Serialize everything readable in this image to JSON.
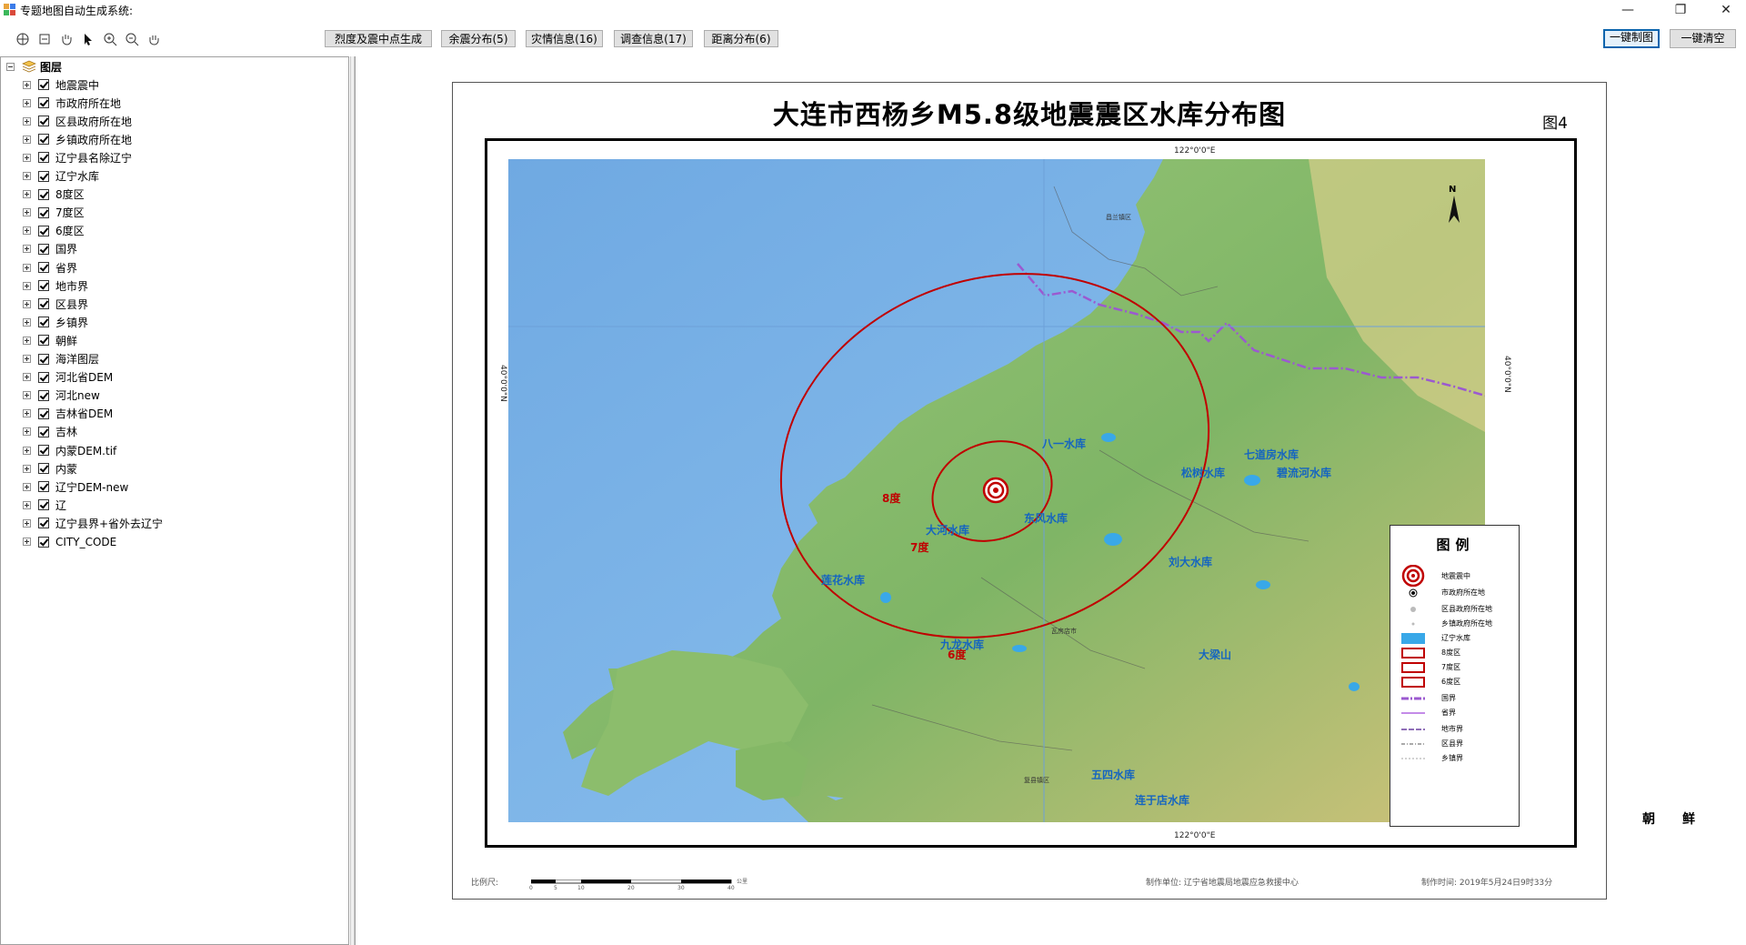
{
  "window": {
    "title": "专题地图自动生成系统:",
    "min_symbol": "—",
    "max_symbol": "❐",
    "close_symbol": "✕"
  },
  "toolbar": {
    "icons": [
      "full-extent-icon",
      "previous-extent-icon",
      "pan-hand-icon",
      "select-arrow-icon",
      "zoom-in-icon",
      "zoom-out-icon",
      "grab-hand-icon"
    ],
    "commands": [
      {
        "label": "烈度及震中点生成"
      },
      {
        "label": "余震分布(5)"
      },
      {
        "label": "灾情信息(16)"
      },
      {
        "label": "调查信息(17)"
      },
      {
        "label": "距离分布(6)"
      }
    ],
    "make_map": "一键制图",
    "clear_all": "一键清空"
  },
  "layers": {
    "root": "图层",
    "items": [
      "地震震中",
      "市政府所在地",
      "区县政府所在地",
      "乡镇政府所在地",
      "辽宁县名除辽宁",
      "辽宁水库",
      "8度区",
      "7度区",
      "6度区",
      "国界",
      "省界",
      "地市界",
      "区县界",
      "乡镇界",
      "朝鲜",
      "海洋图层",
      "河北省DEM",
      "河北new",
      "吉林省DEM",
      "吉林",
      "内蒙DEM.tif",
      "内蒙",
      "辽宁DEM-new",
      "辽",
      "辽宁县界+省外去辽宁",
      "CITY_CODE"
    ]
  },
  "map": {
    "title": "大连市西杨乡M5.8级地震震区水库分布图",
    "figure_no": "图4",
    "grid": {
      "top_lon": "122°0'0\"E",
      "bottom_lon": "122°0'0\"E",
      "left_lat": "40°0'0\"N",
      "right_lat": "40°0'0\"N"
    },
    "north_arrow": "N",
    "reservoirs": [
      "八一水库",
      "松树水库",
      "七道房水库",
      "碧流河水库",
      "大河水库",
      "东风水库",
      "刘大水库",
      "莲花水库",
      "九龙水库",
      "大梁山",
      "五四水库",
      "连于店水库"
    ],
    "zones": [
      "8度",
      "7度",
      "6度"
    ],
    "small_places": [
      "瓦房店市",
      "昌兰镇区",
      "复县镇区"
    ],
    "neighbor": "朝鲜",
    "legend": {
      "title": "图例",
      "items": [
        "地震震中",
        "市政府所在地",
        "区县政府所在地",
        "乡镇政府所在地",
        "辽宁水库",
        "8度区",
        "7度区",
        "6度区",
        "国界",
        "省界",
        "地市界",
        "区县界",
        "乡镇界"
      ]
    },
    "footer": {
      "scale_label": "比例尺:",
      "scale_ticks": [
        "0",
        "5",
        "10",
        "20",
        "30",
        "40"
      ],
      "scale_unit": "公里",
      "maker": "制作单位: 辽宁省地震局地震应急救援中心",
      "time": "制作时间: 2019年5月24日9时33分"
    },
    "colors": {
      "sea": "#7fb6e8",
      "land": "#8fbf6a",
      "intensity": "#c00000",
      "border": "#9b59d0"
    }
  }
}
